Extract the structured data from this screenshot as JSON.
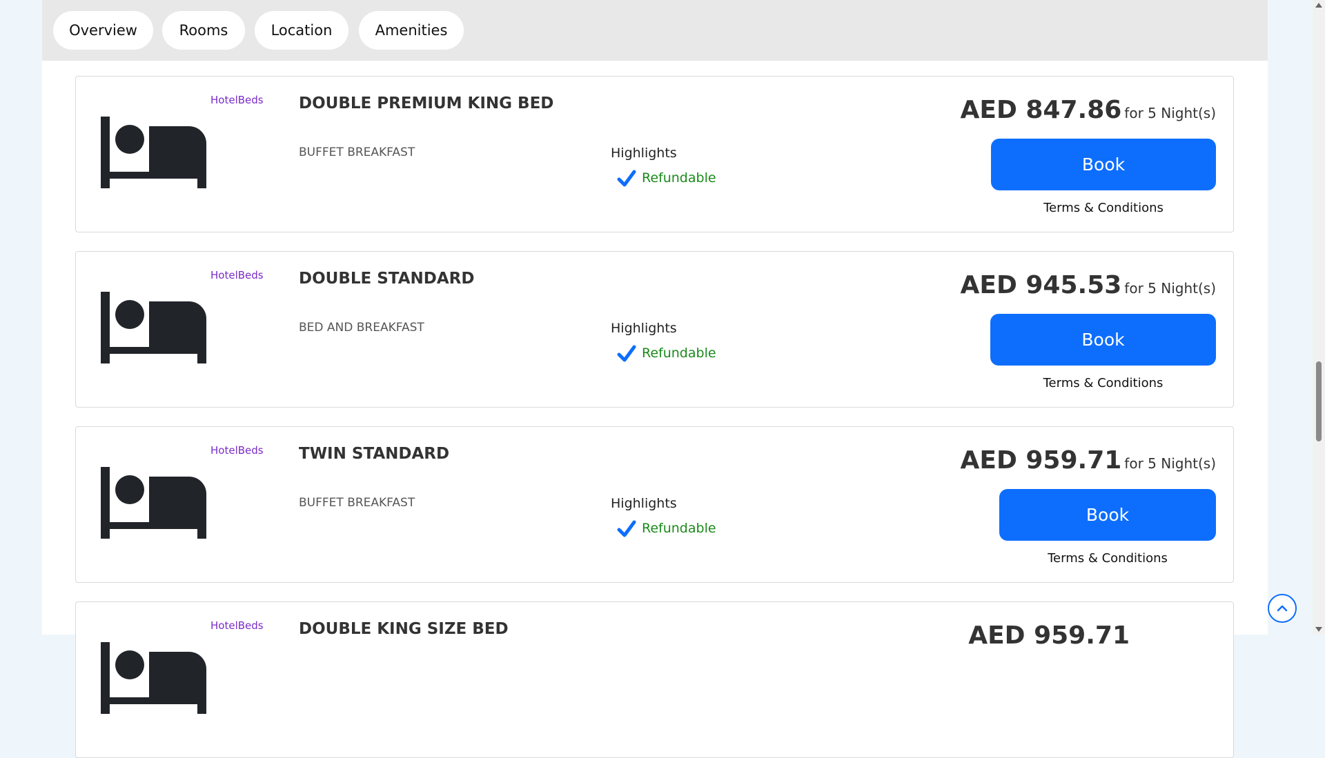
{
  "tabs": [
    "Overview",
    "Rooms",
    "Location",
    "Amenities"
  ],
  "colors": {
    "primary": "#0d6efd",
    "supplier": "#7a2bc8",
    "refundable": "#1a8a1a",
    "tabs_bg": "#e8e8e8"
  },
  "rooms": [
    {
      "supplier": "HotelBeds",
      "name": "DOUBLE PREMIUM KING BED",
      "board": "BUFFET BREAKFAST",
      "highlights_title": "Highlights",
      "highlight": "Refundable",
      "price": "AED 847.86",
      "nights": "for 5 Night(s)",
      "book_label": "Book",
      "terms_label": "Terms & Conditions"
    },
    {
      "supplier": "HotelBeds",
      "name": "DOUBLE STANDARD",
      "board": "BED AND BREAKFAST",
      "highlights_title": "Highlights",
      "highlight": "Refundable",
      "price": "AED 945.53",
      "nights": "for 5 Night(s)",
      "book_label": "Book",
      "terms_label": "Terms & Conditions"
    },
    {
      "supplier": "HotelBeds",
      "name": "TWIN STANDARD",
      "board": "BUFFET BREAKFAST",
      "highlights_title": "Highlights",
      "highlight": "Refundable",
      "price": "AED 959.71",
      "nights": "for 5 Night(s)",
      "book_label": "Book",
      "terms_label": "Terms & Conditions"
    },
    {
      "supplier": "HotelBeds",
      "name": "DOUBLE KING SIZE BED",
      "board": "",
      "highlights_title": "",
      "highlight": "",
      "price": "AED 959.71",
      "nights": "",
      "book_label": "",
      "terms_label": ""
    }
  ],
  "icons": {
    "bed": "bed-icon",
    "check": "check-icon",
    "back_to_top": "chevron-up-icon"
  }
}
